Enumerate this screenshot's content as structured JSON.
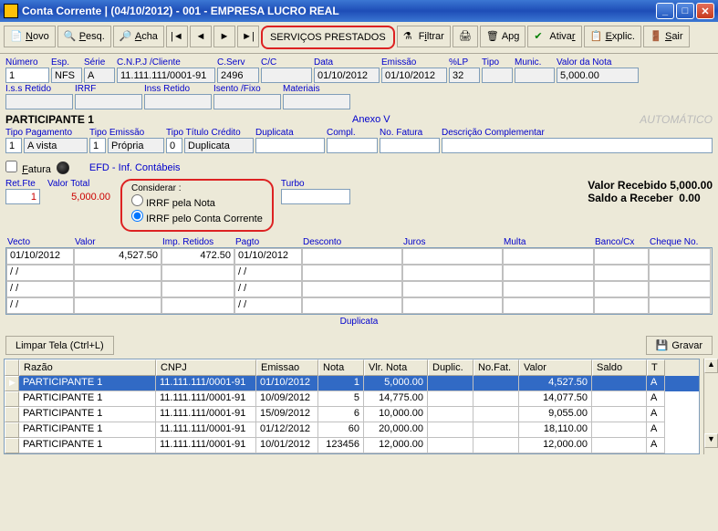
{
  "title": "Conta Corrente |  (04/10/2012) - 001 - EMPRESA LUCRO REAL",
  "toolbar": {
    "novo": "Novo",
    "pesq": "Pesq.",
    "acha": "Acha",
    "servicos": "SERVIÇOS PRESTADOS",
    "filtrar": "Filtrar",
    "print": "",
    "apg": "Apg",
    "ativar": "Ativar",
    "explic": "Explic.",
    "sair": "Sair"
  },
  "hdr": {
    "numero_l": "Número",
    "numero": "1",
    "esp_l": "Esp.",
    "esp": "NFS",
    "serie_l": "Série",
    "serie": "A",
    "cnpj_l": "C.N.P.J /Cliente",
    "cnpj": "11.111.111/0001-91",
    "cserv_l": "C.Serv",
    "cserv": "2496",
    "cc_l": "C/C",
    "cc": "",
    "data_l": "Data",
    "data": "01/10/2012",
    "emissao_l": "Emissão",
    "emissao": "01/10/2012",
    "lp_l": "%LP",
    "lp": "32",
    "tipo_l": "Tipo",
    "tipo": "",
    "munic_l": "Munic.",
    "munic": "",
    "valor_nota_l": "Valor da Nota",
    "valor_nota": "5,000.00"
  },
  "ret": {
    "iss_l": "I.s.s Retido",
    "iss": "",
    "irrf_l": "IRRF",
    "irrf": "",
    "inss_l": "Inss Retido",
    "inss": "",
    "isento_l": "Isento /Fixo",
    "isento": "",
    "mat_l": "Materiais",
    "mat": ""
  },
  "participante": "PARTICIPANTE 1",
  "anexo": "Anexo V",
  "automatico": "AUTOMÁTICO",
  "pag": {
    "tp_l": "Tipo Pagamento",
    "tp_n": "1",
    "tp_t": "A vista",
    "te_l": "Tipo Emissão",
    "te_n": "1",
    "te_t": "Própria",
    "tc_l": "Tipo Título Crédito",
    "tc_n": "0",
    "tc_t": "Duplicata",
    "dup_l": "Duplicata",
    "dup": "",
    "compl_l": "Compl.",
    "compl": "",
    "nof_l": "No. Fatura",
    "nof": "",
    "desc_l": "Descrição Complementar",
    "desc": ""
  },
  "fatura_l": "Fatura",
  "efd_l": "EFD - Inf. Contábeis",
  "retfte_l": "Ret.Fte",
  "retfte": "1",
  "valtot_l": "Valor Total",
  "valtot": "5,000.00",
  "cons": {
    "title": "Considerar :",
    "opt1": "IRRF pela Nota",
    "opt2": "IRRF pelo Conta Corrente"
  },
  "turbo_l": "Turbo",
  "turbo": "",
  "recebido_l": "Valor Recebido",
  "recebido_v": "5,000.00",
  "saldo_l": "Saldo a Receber",
  "saldo_v": "0.00",
  "gridh": {
    "vecto": "Vecto",
    "valor": "Valor",
    "impret": "Imp. Retidos",
    "pagto": "Pagto",
    "desc": "Desconto",
    "juros": "Juros",
    "multa": "Multa",
    "banco": "Banco/Cx",
    "cheque": "Cheque No."
  },
  "gridrows": [
    {
      "vecto": "01/10/2012",
      "valor": "4,527.50",
      "impret": "472.50",
      "pagto": "01/10/2012",
      "desc": "",
      "juros": "",
      "multa": "",
      "banco": "",
      "cheque": ""
    },
    {
      "vecto": "  /  /",
      "valor": "",
      "impret": "",
      "pagto": "  /  /",
      "desc": "",
      "juros": "",
      "multa": "",
      "banco": "",
      "cheque": ""
    },
    {
      "vecto": "  /  /",
      "valor": "",
      "impret": "",
      "pagto": "  /  /",
      "desc": "",
      "juros": "",
      "multa": "",
      "banco": "",
      "cheque": ""
    },
    {
      "vecto": "  /  /",
      "valor": "",
      "impret": "",
      "pagto": "  /  /",
      "desc": "",
      "juros": "",
      "multa": "",
      "banco": "",
      "cheque": ""
    }
  ],
  "duplicata_mid": "Duplicata",
  "limpar": "Limpar Tela (Ctrl+L)",
  "gravar": "Gravar",
  "bgh": {
    "razao": "Razão",
    "cnpj": "CNPJ",
    "emissao": "Emissao",
    "nota": "Nota",
    "vlnota": "Vlr. Nota",
    "duplic": "Duplic.",
    "nofat": "No.Fat.",
    "valor": "Valor",
    "saldo": "Saldo",
    "t": "T"
  },
  "bgrows": [
    {
      "razao": "PARTICIPANTE 1",
      "cnpj": "11.111.111/0001-91",
      "emissao": "01/10/2012",
      "nota": "1",
      "vlnota": "5,000.00",
      "duplic": "",
      "nofat": "",
      "valor": "4,527.50",
      "saldo": "",
      "t": "A"
    },
    {
      "razao": "PARTICIPANTE 1",
      "cnpj": "11.111.111/0001-91",
      "emissao": "10/09/2012",
      "nota": "5",
      "vlnota": "14,775.00",
      "duplic": "",
      "nofat": "",
      "valor": "14,077.50",
      "saldo": "",
      "t": "A"
    },
    {
      "razao": "PARTICIPANTE 1",
      "cnpj": "11.111.111/0001-91",
      "emissao": "15/09/2012",
      "nota": "6",
      "vlnota": "10,000.00",
      "duplic": "",
      "nofat": "",
      "valor": "9,055.00",
      "saldo": "",
      "t": "A"
    },
    {
      "razao": "PARTICIPANTE 1",
      "cnpj": "11.111.111/0001-91",
      "emissao": "01/12/2012",
      "nota": "60",
      "vlnota": "20,000.00",
      "duplic": "",
      "nofat": "",
      "valor": "18,110.00",
      "saldo": "",
      "t": "A"
    },
    {
      "razao": "PARTICIPANTE 1",
      "cnpj": "11.111.111/0001-91",
      "emissao": "10/01/2012",
      "nota": "123456",
      "vlnota": "12,000.00",
      "duplic": "",
      "nofat": "",
      "valor": "12,000.00",
      "saldo": "",
      "t": "A"
    }
  ]
}
